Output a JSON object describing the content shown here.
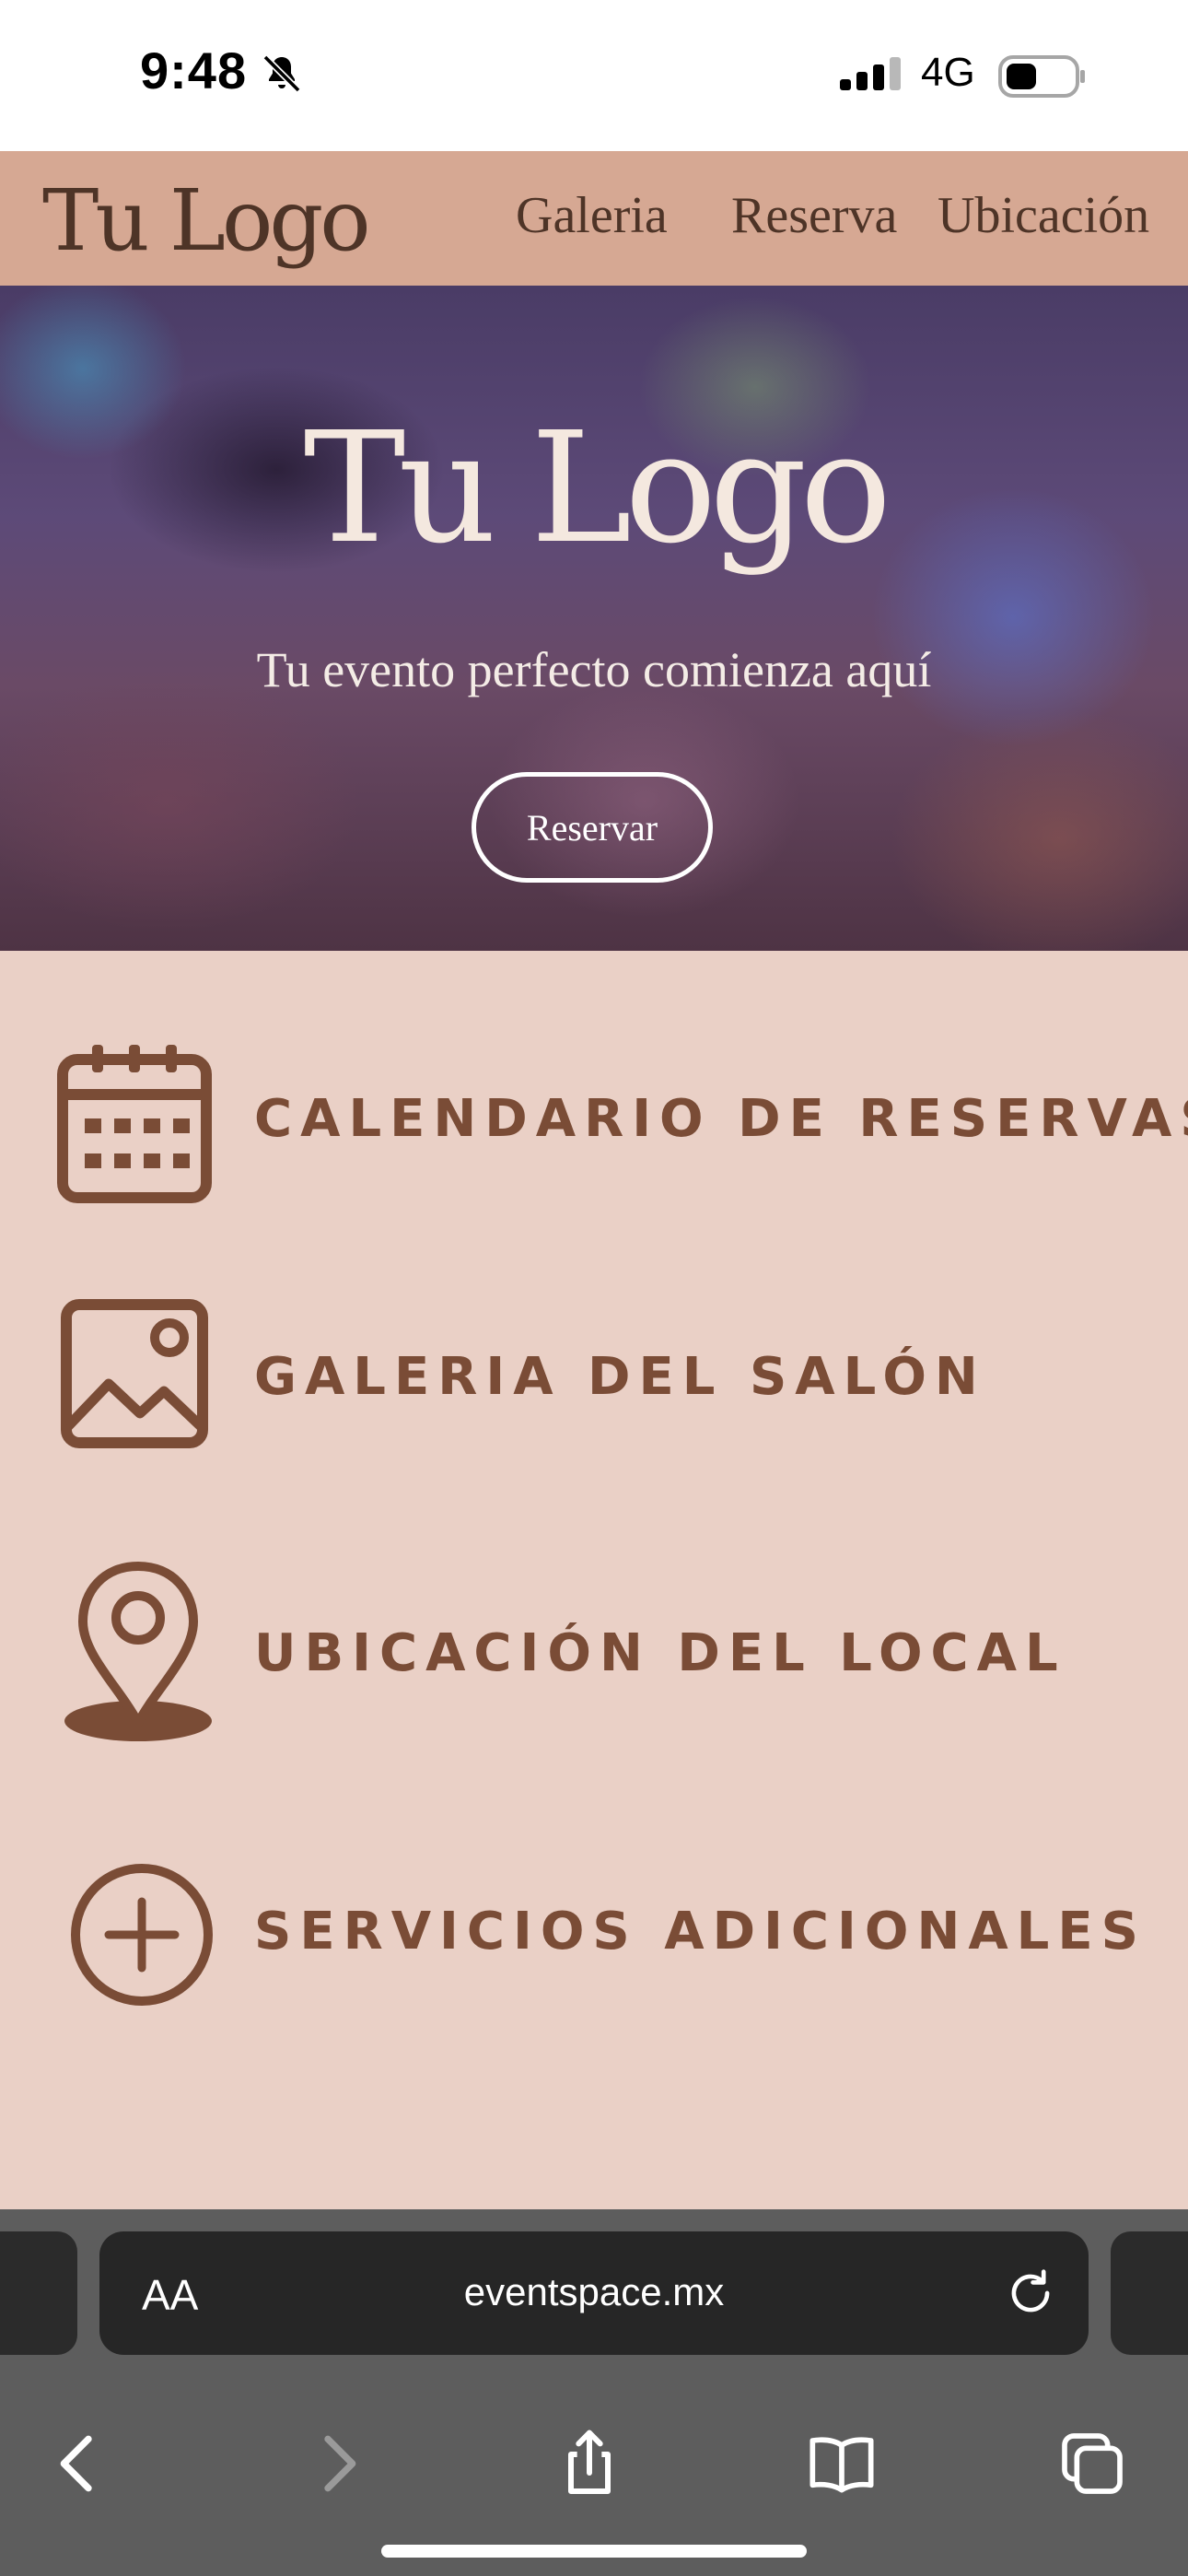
{
  "status_bar": {
    "time": "9:48",
    "network": "4G",
    "icons": [
      "bell-slash-icon",
      "signal-icon",
      "battery-icon"
    ]
  },
  "header": {
    "logo": "Tu Logo",
    "nav": [
      {
        "label": "Galeria"
      },
      {
        "label": "Reserva"
      },
      {
        "label": "Ubicación"
      }
    ]
  },
  "hero": {
    "logo": "Tu Logo",
    "tagline": "Tu evento perfecto comienza aquí",
    "button_label": "Reservar"
  },
  "features": [
    {
      "label": "CALENDARIO DE RESERVAS",
      "icon": "calendar-icon"
    },
    {
      "label": "GALERIA DEL SALÓN",
      "icon": "image-icon"
    },
    {
      "label": "UBICACIÓN DEL LOCAL",
      "icon": "location-pin-icon"
    },
    {
      "label": "SERVICIOS ADICIONALES",
      "icon": "plus-circle-icon"
    }
  ],
  "browser": {
    "text_size_label": "AA",
    "url": "eventspace.mx",
    "toolbar": [
      "back-icon",
      "forward-icon",
      "share-icon",
      "bookmarks-icon",
      "tabs-icon"
    ]
  },
  "colors": {
    "header_bg": "#d6a893",
    "page_bg": "#ead0c6",
    "accent_brown": "#7a4c36",
    "browser_bar": "#5d5d5d"
  }
}
